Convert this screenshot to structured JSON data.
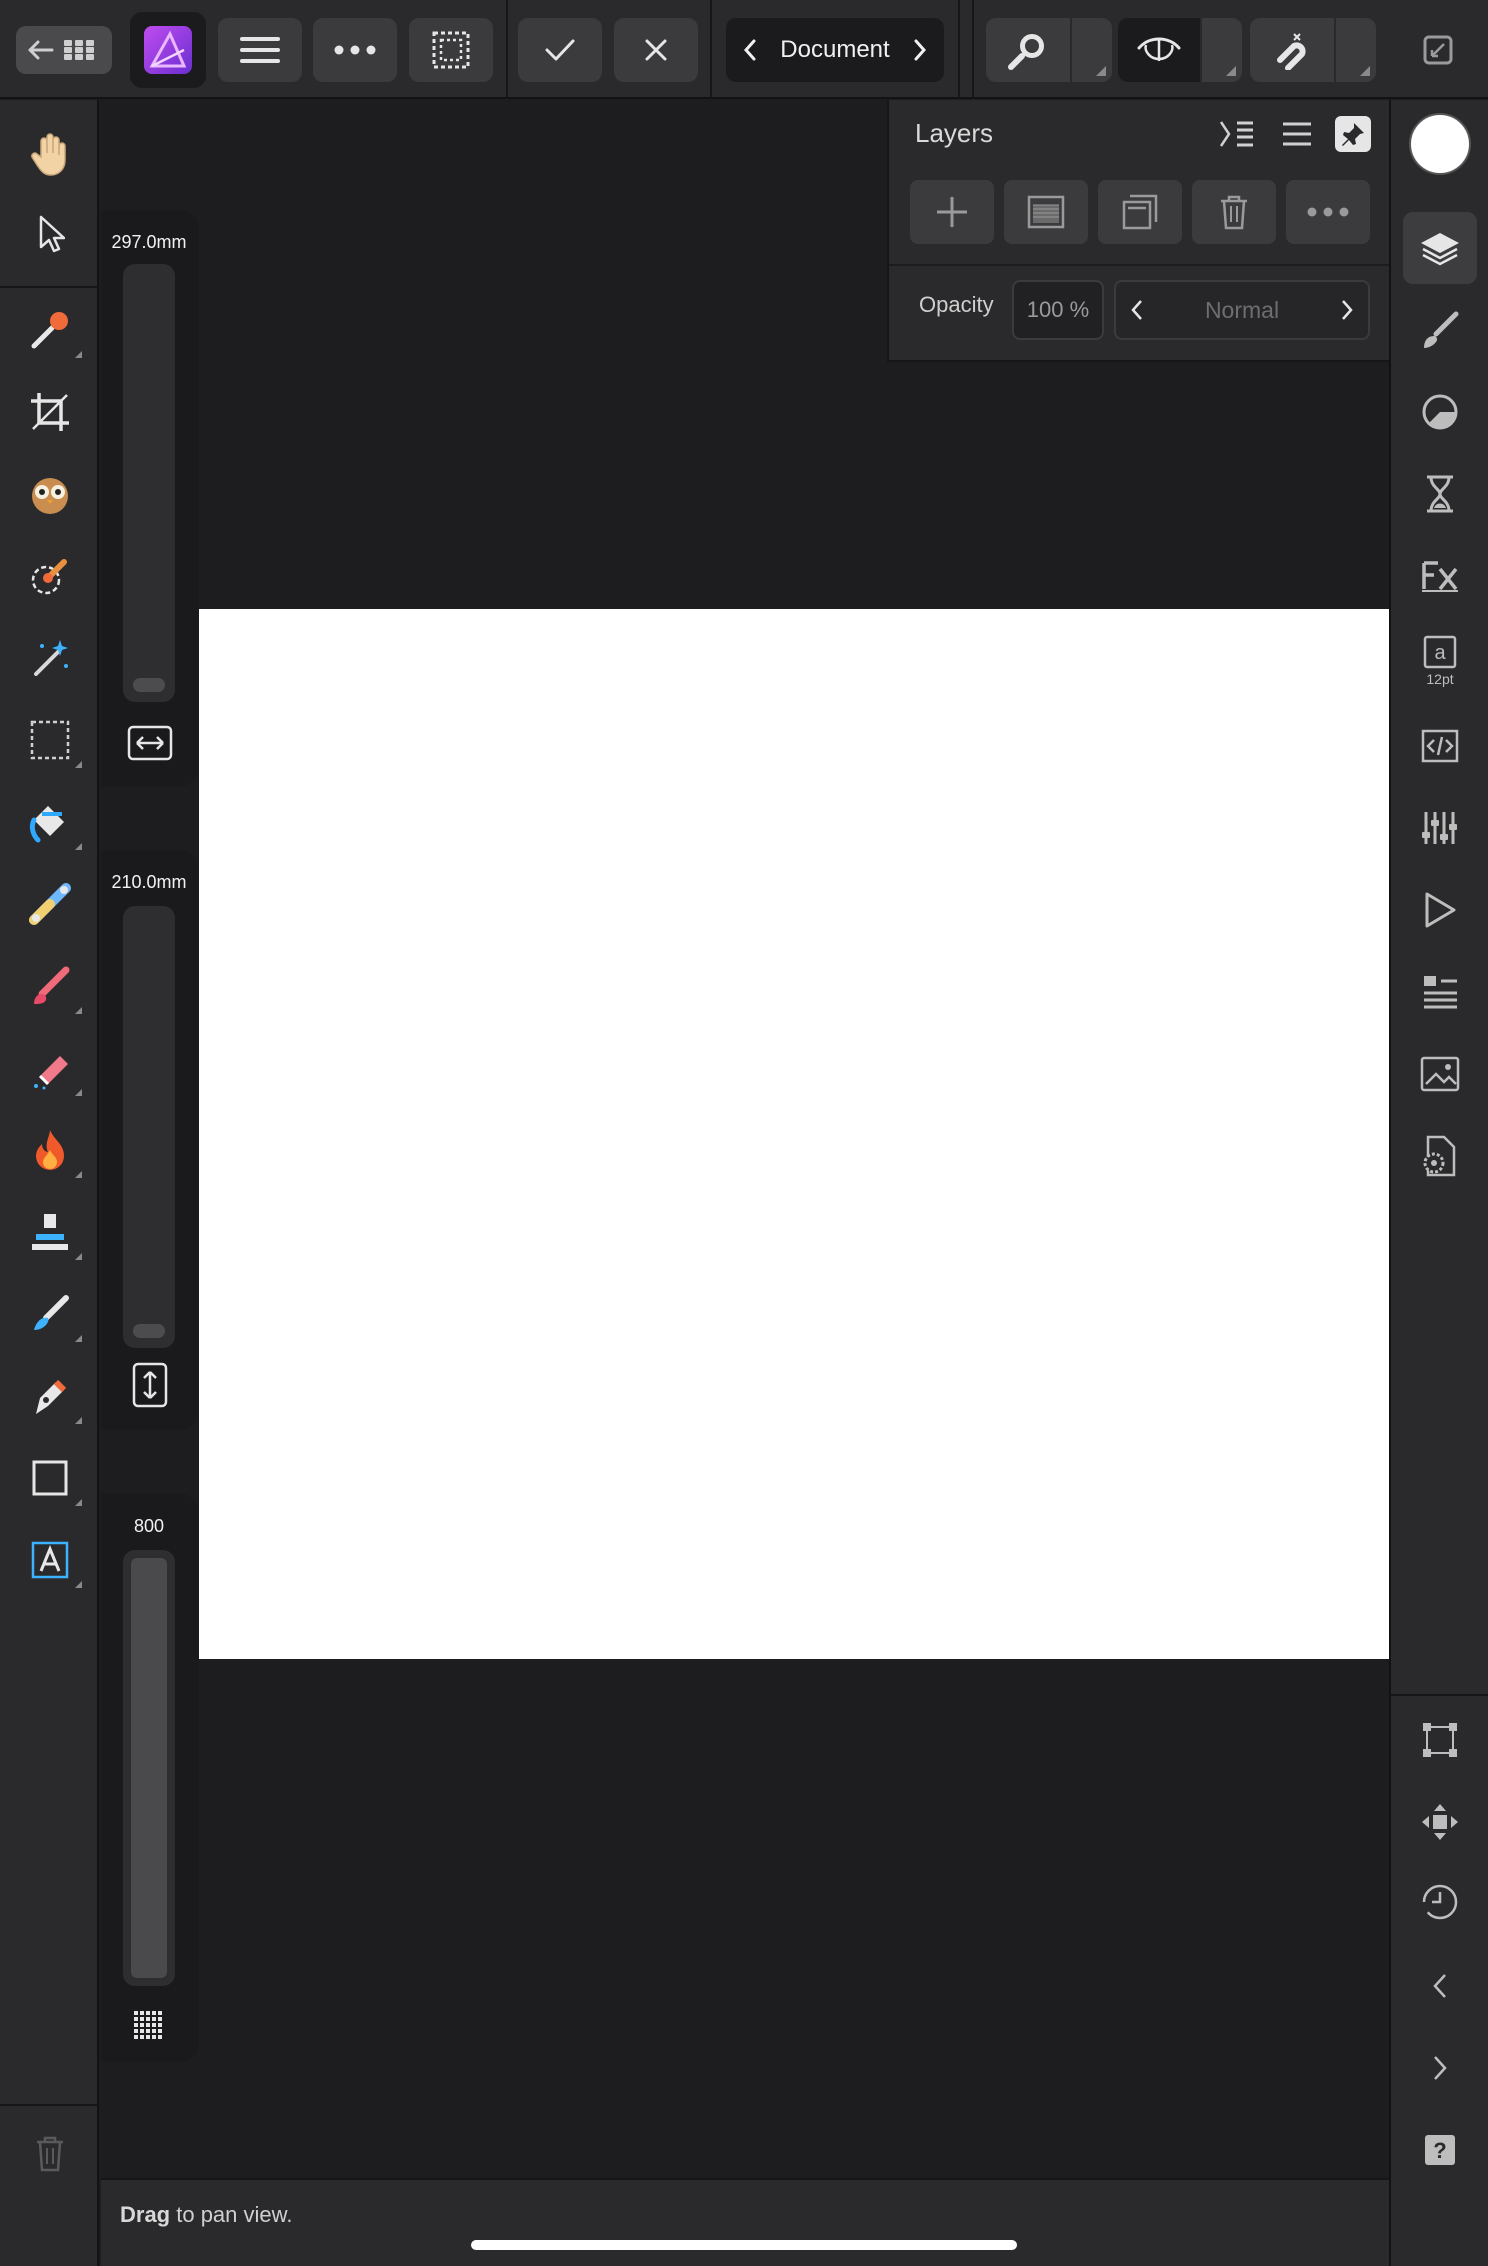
{
  "toolbar": {
    "document_label": "Document"
  },
  "layers_panel": {
    "title": "Layers",
    "opacity_label": "Opacity",
    "opacity_value": "100 %",
    "blend_mode": "Normal"
  },
  "sliders": [
    {
      "value": "297.0mm",
      "level": 0.0
    },
    {
      "value": "210.0mm",
      "level": 0.0
    },
    {
      "value": "800",
      "level": 1.0
    }
  ],
  "right_rail": {
    "character_size": "12pt"
  },
  "status": {
    "action": "Drag",
    "message": " to pan view."
  },
  "colors": {
    "accent": "#b94df0",
    "background": "#1d1d1f",
    "panel": "#2a2a2c",
    "page": "#ffffff"
  }
}
